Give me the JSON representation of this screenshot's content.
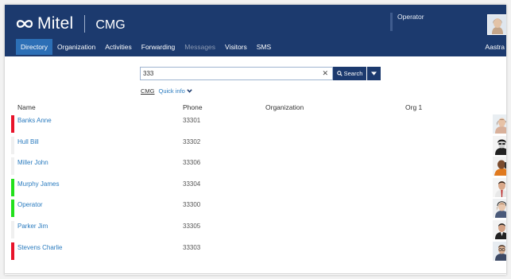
{
  "header": {
    "brand": "Mitel",
    "app_name": "CMG",
    "operator_label": "Operator",
    "user_name": "Aastra",
    "bg_color": "#1c3a6e",
    "active_tab_color": "#2c6fb6"
  },
  "tabs": [
    {
      "label": "Directory",
      "active": true,
      "enabled": true
    },
    {
      "label": "Organization",
      "active": false,
      "enabled": true
    },
    {
      "label": "Activities",
      "active": false,
      "enabled": true
    },
    {
      "label": "Forwarding",
      "active": false,
      "enabled": true
    },
    {
      "label": "Messages",
      "active": false,
      "enabled": false
    },
    {
      "label": "Visitors",
      "active": false,
      "enabled": true
    },
    {
      "label": "SMS",
      "active": false,
      "enabled": true
    }
  ],
  "search": {
    "value": "333",
    "button_label": "Search",
    "subtab_active": "CMG",
    "subtab_quick_info": "Quick info"
  },
  "columns": {
    "name": "Name",
    "phone": "Phone",
    "organization": "Organization",
    "org1": "Org 1"
  },
  "rows": [
    {
      "name": "Banks Anne",
      "phone": "33301",
      "presence": "#e8142b",
      "avatar": "woman-photo"
    },
    {
      "name": "Hull Bill",
      "phone": "33302",
      "presence": "#f0f0f0",
      "avatar": "man-bw-photo"
    },
    {
      "name": "Miller John",
      "phone": "33306",
      "presence": "#f0f0f0",
      "avatar": "man-phone-photo"
    },
    {
      "name": "Murphy James",
      "phone": "33304",
      "presence": "#22e01c",
      "avatar": "man-tie-photo"
    },
    {
      "name": "Operator",
      "phone": "33300",
      "presence": "#22e01c",
      "avatar": "woman-headset-photo"
    },
    {
      "name": "Parker Jim",
      "phone": "33305",
      "presence": "#f0f0f0",
      "avatar": "man-suit-photo"
    },
    {
      "name": "Stevens Charlie",
      "phone": "33303",
      "presence": "#e8142b",
      "avatar": "man-glasses-photo"
    }
  ]
}
